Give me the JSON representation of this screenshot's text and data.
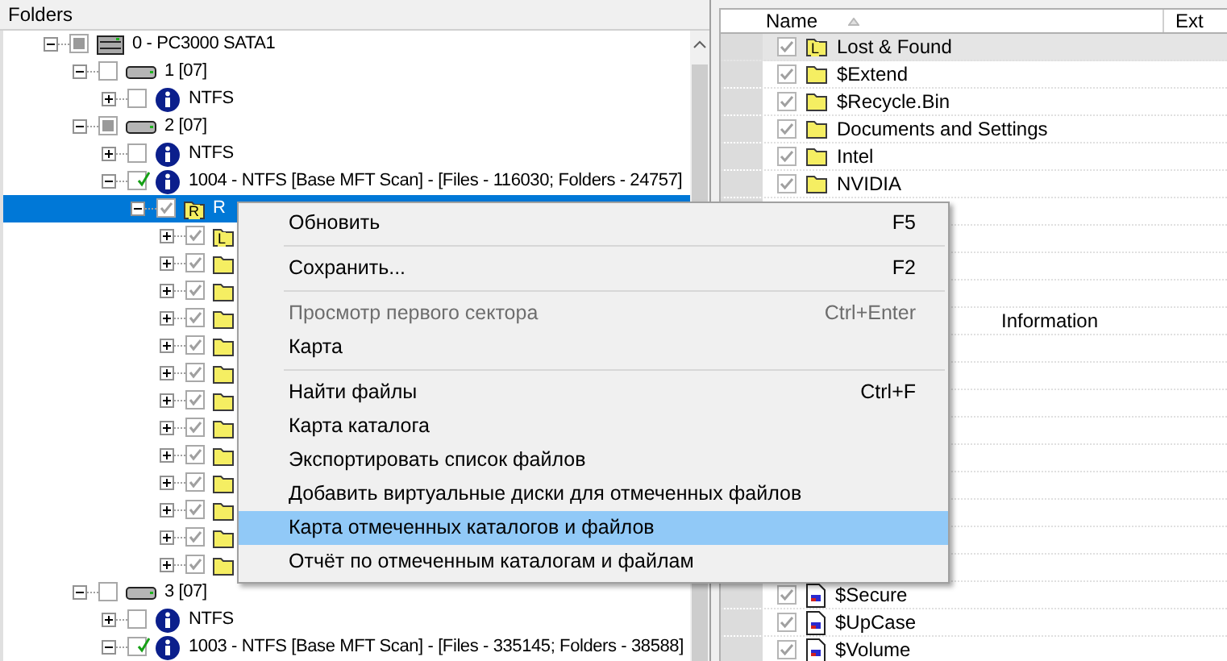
{
  "left_pane": {
    "title": "Folders",
    "tree": [
      {
        "kind": "disk",
        "label": "0 - PC3000 SATA1",
        "checked": false,
        "partial": true,
        "marked": false,
        "expanded": true,
        "selected": false,
        "children": [
          {
            "kind": "partition",
            "label": "1 [07]",
            "checked": false,
            "partial": false,
            "marked": false,
            "expanded": true,
            "selected": false,
            "children": [
              {
                "kind": "info",
                "label": "NTFS",
                "checked": false,
                "partial": false,
                "marked": false,
                "expanded": false,
                "selected": false
              }
            ]
          },
          {
            "kind": "partition",
            "label": "2 [07]",
            "checked": false,
            "partial": true,
            "marked": false,
            "expanded": true,
            "selected": false,
            "children": [
              {
                "kind": "info",
                "label": "NTFS",
                "checked": false,
                "partial": false,
                "marked": false,
                "expanded": false,
                "selected": false
              },
              {
                "kind": "info",
                "label": "1004 - NTFS [Base MFT Scan] - [Files - 116030; Folders - 24757]",
                "checked": false,
                "partial": false,
                "marked": true,
                "expanded": true,
                "selected": false,
                "children": [
                  {
                    "kind": "folder",
                    "badge": "R",
                    "label": "R",
                    "checked": true,
                    "partial": false,
                    "marked": false,
                    "expanded": true,
                    "selected": true,
                    "children": [
                      {
                        "kind": "folder",
                        "badge": "L",
                        "checked": true,
                        "partial": false,
                        "marked": false,
                        "expanded": false,
                        "selected": false
                      },
                      {
                        "kind": "folder",
                        "checked": true,
                        "partial": false,
                        "marked": false,
                        "expanded": false,
                        "selected": false
                      },
                      {
                        "kind": "folder",
                        "checked": true,
                        "partial": false,
                        "marked": false,
                        "expanded": false,
                        "selected": false
                      },
                      {
                        "kind": "folder",
                        "checked": true,
                        "partial": false,
                        "marked": false,
                        "expanded": false,
                        "selected": false
                      },
                      {
                        "kind": "folder",
                        "checked": true,
                        "partial": false,
                        "marked": false,
                        "expanded": false,
                        "selected": false
                      },
                      {
                        "kind": "folder",
                        "checked": true,
                        "partial": false,
                        "marked": false,
                        "expanded": false,
                        "selected": false
                      },
                      {
                        "kind": "folder",
                        "checked": true,
                        "partial": false,
                        "marked": false,
                        "expanded": false,
                        "selected": false
                      },
                      {
                        "kind": "folder",
                        "checked": true,
                        "partial": false,
                        "marked": false,
                        "expanded": false,
                        "selected": false
                      },
                      {
                        "kind": "folder",
                        "checked": true,
                        "partial": false,
                        "marked": false,
                        "expanded": false,
                        "selected": false
                      },
                      {
                        "kind": "folder",
                        "checked": true,
                        "partial": false,
                        "marked": false,
                        "expanded": false,
                        "selected": false
                      },
                      {
                        "kind": "folder",
                        "checked": true,
                        "partial": false,
                        "marked": false,
                        "expanded": false,
                        "selected": false
                      },
                      {
                        "kind": "folder",
                        "checked": true,
                        "partial": false,
                        "marked": false,
                        "expanded": false,
                        "selected": false
                      },
                      {
                        "kind": "folder",
                        "checked": true,
                        "partial": false,
                        "marked": false,
                        "expanded": false,
                        "selected": false
                      }
                    ]
                  }
                ]
              }
            ]
          },
          {
            "kind": "partition",
            "label": "3 [07]",
            "checked": false,
            "partial": false,
            "marked": false,
            "expanded": true,
            "selected": false,
            "children": [
              {
                "kind": "info",
                "label": "NTFS",
                "checked": false,
                "partial": false,
                "marked": false,
                "expanded": false,
                "selected": false
              },
              {
                "kind": "info",
                "label": "1003 - NTFS [Base MFT Scan] - [Files - 335145; Folders - 38588]",
                "checked": false,
                "partial": false,
                "marked": true,
                "expanded": true,
                "selected": false
              }
            ]
          }
        ]
      }
    ]
  },
  "right_pane": {
    "columns": [
      {
        "label": "Name",
        "sorted": true
      },
      {
        "label": "Ext",
        "sorted": false
      }
    ],
    "rows_top": [
      {
        "name": "Lost & Found",
        "kind": "folder",
        "badge": "L",
        "checked": true,
        "selected": true
      },
      {
        "name": "$Extend",
        "kind": "folder",
        "checked": true,
        "selected": false
      },
      {
        "name": "$Recycle.Bin",
        "kind": "folder",
        "checked": true,
        "selected": false
      },
      {
        "name": "Documents and Settings",
        "kind": "folder",
        "checked": true,
        "selected": false
      },
      {
        "name": "Intel",
        "kind": "folder",
        "checked": true,
        "selected": false
      },
      {
        "name": "NVIDIA",
        "kind": "folder",
        "checked": true,
        "selected": false
      }
    ],
    "rows_middle": [
      {
        "name": "Information"
      }
    ],
    "rows_bottom": [
      {
        "name": "$Secure",
        "kind": "file",
        "checked": true,
        "selected": false
      },
      {
        "name": "$UpCase",
        "kind": "file",
        "checked": true,
        "selected": false
      },
      {
        "name": "$Volume",
        "kind": "file",
        "checked": true,
        "selected": false
      }
    ]
  },
  "context_menu": {
    "items": [
      {
        "kind": "item",
        "label": "Обновить",
        "shortcut": "F5",
        "disabled": false,
        "selected": false
      },
      {
        "kind": "separator"
      },
      {
        "kind": "item",
        "label": "Сохранить...",
        "shortcut": "F2",
        "disabled": false,
        "selected": false
      },
      {
        "kind": "separator"
      },
      {
        "kind": "item",
        "label": "Просмотр первого сектора",
        "shortcut": "Ctrl+Enter",
        "disabled": true,
        "selected": false
      },
      {
        "kind": "item",
        "label": "Карта",
        "disabled": false,
        "selected": false
      },
      {
        "kind": "separator"
      },
      {
        "kind": "item",
        "label": "Найти файлы",
        "shortcut": "Ctrl+F",
        "disabled": false,
        "selected": false
      },
      {
        "kind": "item",
        "label": "Карта каталога",
        "disabled": false,
        "selected": false
      },
      {
        "kind": "item",
        "label": "Экспортировать список файлов",
        "disabled": false,
        "selected": false
      },
      {
        "kind": "item",
        "label": "Добавить виртуальные диски для отмеченных файлов",
        "disabled": false,
        "selected": false
      },
      {
        "kind": "item",
        "label": "Карта отмеченных каталогов и файлов",
        "disabled": false,
        "selected": true
      },
      {
        "kind": "item",
        "label": "Отчёт по отмеченным каталогам и файлам",
        "disabled": false,
        "selected": false
      }
    ]
  }
}
